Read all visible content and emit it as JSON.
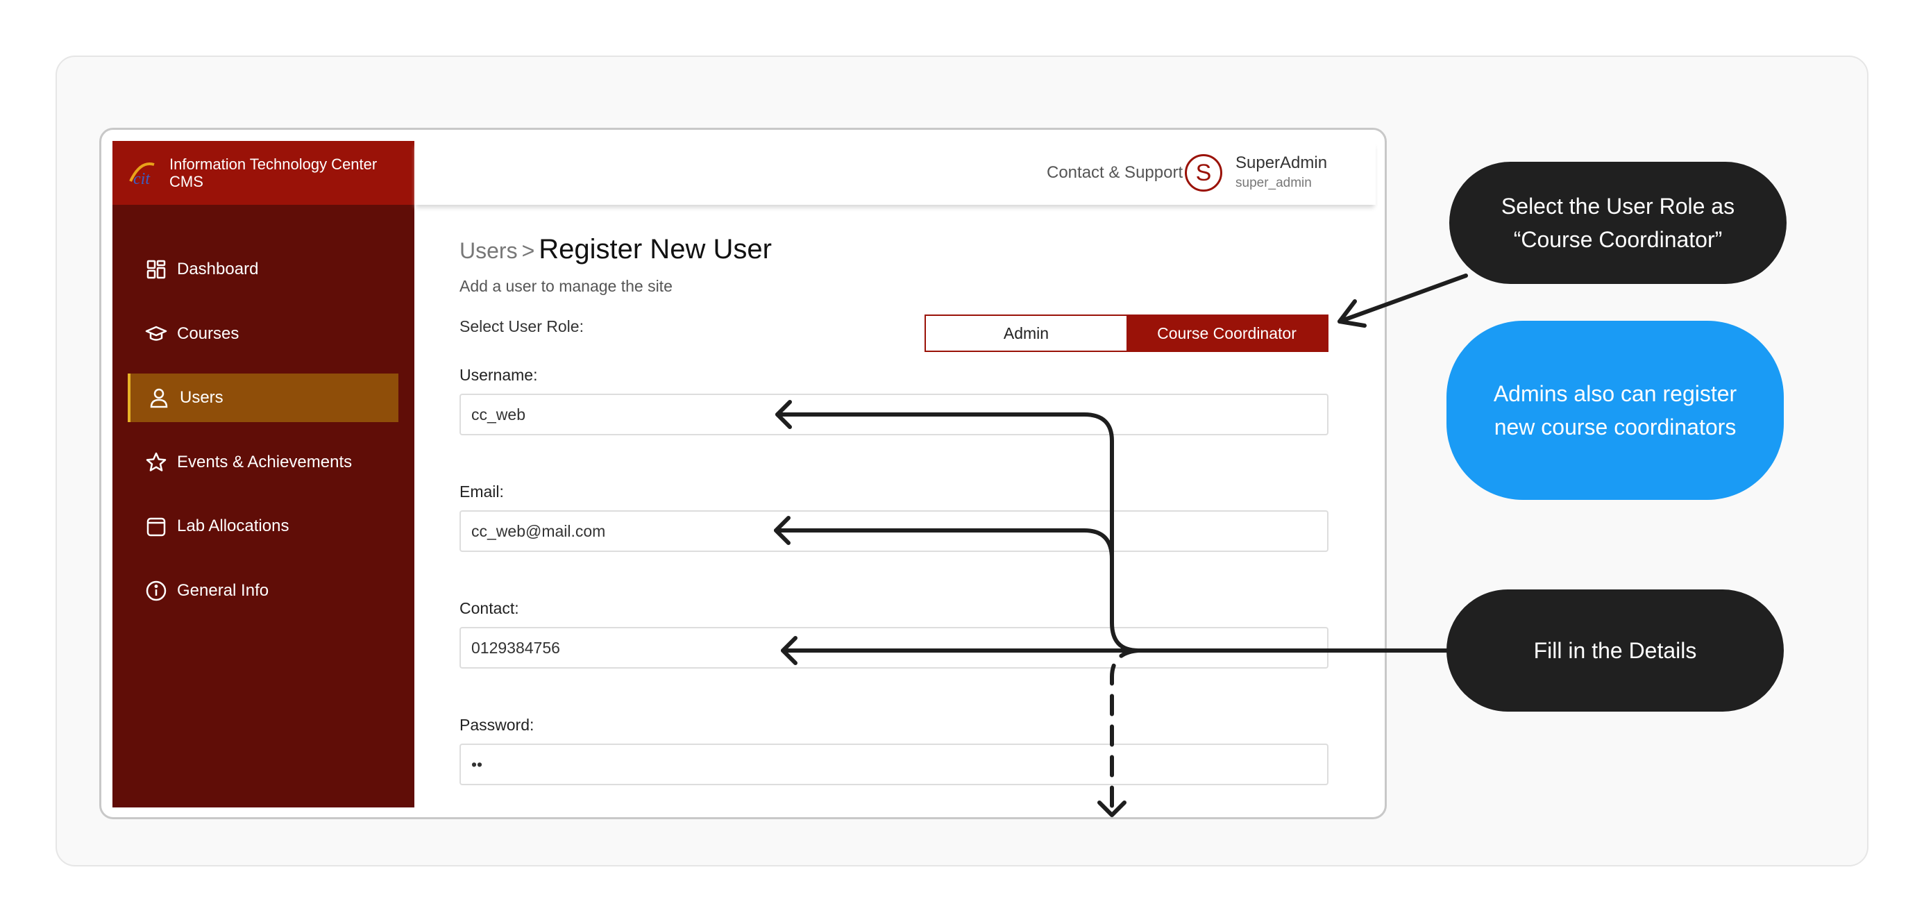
{
  "app": {
    "brand_line1": "Information Technology Center",
    "brand_line2": "CMS"
  },
  "sidebar": {
    "items": [
      {
        "label": "Dashboard",
        "icon": "dashboard-grid-icon",
        "active": false
      },
      {
        "label": "Courses",
        "icon": "graduation-cap-icon",
        "active": false
      },
      {
        "label": "Users",
        "icon": "user-icon",
        "active": true
      },
      {
        "label": "Events & Achievements",
        "icon": "star-icon",
        "active": false
      },
      {
        "label": "Lab Allocations",
        "icon": "calendar-icon",
        "active": false
      },
      {
        "label": "General Info",
        "icon": "info-icon",
        "active": false
      }
    ]
  },
  "topbar": {
    "contact_label": "Contact & Support",
    "avatar_letter": "S",
    "user_name": "SuperAdmin",
    "user_handle": "super_admin"
  },
  "page": {
    "breadcrumb_parent": "Users",
    "breadcrumb_sep": ">",
    "title": "Register New User",
    "subtitle": "Add a user to manage the site"
  },
  "form": {
    "role_label": "Select User Role:",
    "roles": [
      "Admin",
      "Course Coordinator"
    ],
    "selected_role": "Course Coordinator",
    "fields": [
      {
        "label": "Username:",
        "value": "cc_web"
      },
      {
        "label": "Email:",
        "value": "cc_web@mail.com"
      },
      {
        "label": "Contact:",
        "value": "0129384756"
      },
      {
        "label": "Password:",
        "value": "••"
      }
    ]
  },
  "annotations": {
    "callout_role_line1": "Select the User Role as",
    "callout_role_line2": "“Course Coordinator”",
    "callout_admins_line1": "Admins also can register",
    "callout_admins_line2": "new course coordinators",
    "callout_fill": "Fill in the Details"
  },
  "colors": {
    "brand_red": "#9a1208",
    "sidebar_dark": "#600d07",
    "active_item": "#8f4e09",
    "callout_dark": "#202020",
    "callout_blue": "#1a9bf5"
  }
}
